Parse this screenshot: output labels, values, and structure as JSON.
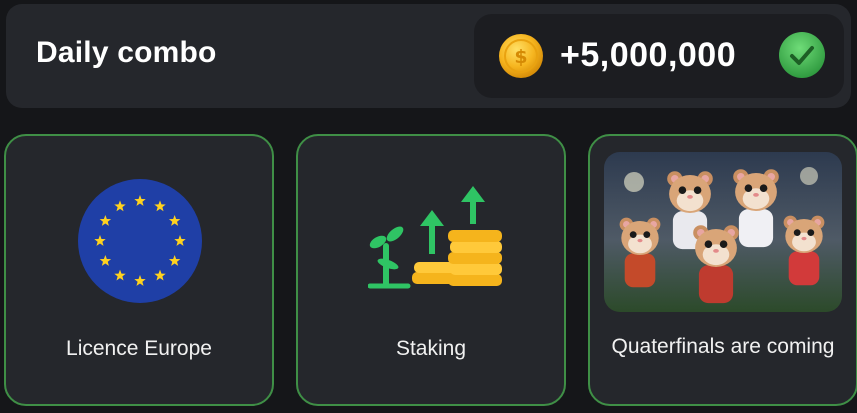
{
  "header": {
    "title": "Daily combo",
    "reward": {
      "coin_icon": "coin-icon",
      "amount": "+5,000,000",
      "status_icon": "checkmark-icon",
      "status_color": "#43b45a"
    }
  },
  "cards": [
    {
      "label": "Licence Europe",
      "image": "eu-flag"
    },
    {
      "label": "Staking",
      "image": "staking-growth"
    },
    {
      "label": "Quaterfinals are coming",
      "image": "hamster-football-team"
    }
  ],
  "colors": {
    "card_border": "#3f8f46",
    "coin": "#f5b41c",
    "eu_blue": "#1f3fa6",
    "eu_star": "#ffd21f",
    "green": "#2fc464"
  }
}
